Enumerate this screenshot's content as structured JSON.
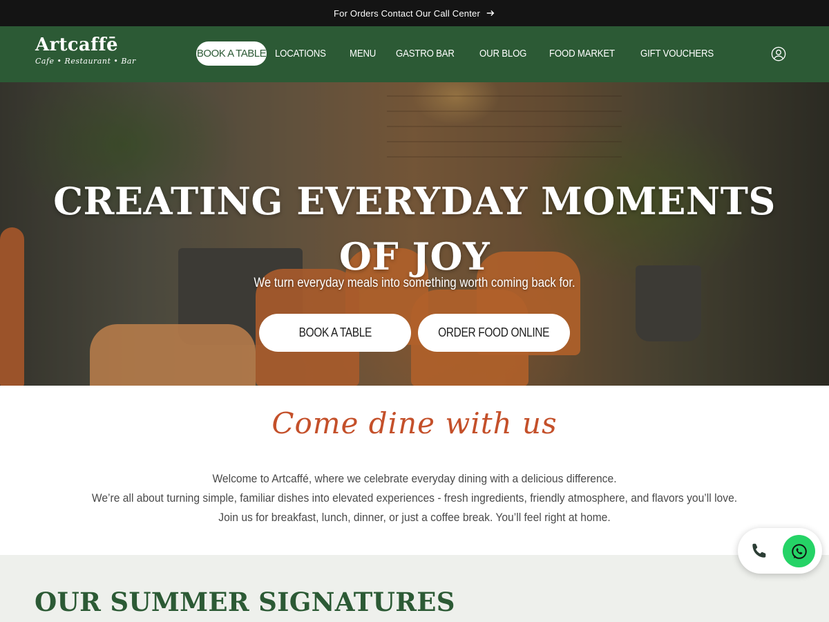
{
  "topbar": {
    "text": "For Orders Contact Our Call Center",
    "arrow_icon": "arrow-right-icon"
  },
  "brand": {
    "name": "Artcaffē",
    "tagline": "Cafe • Restaurant • Bar"
  },
  "nav": {
    "book_label": "BOOK A TABLE",
    "items": [
      {
        "label": "LOCATIONS"
      },
      {
        "label": "MENU"
      },
      {
        "label": "GASTRO BAR"
      },
      {
        "label": "OUR BLOG"
      },
      {
        "label": "FOOD MARKET"
      },
      {
        "label": "GIFT VOUCHERS"
      }
    ],
    "account_icon": "user-account-icon"
  },
  "hero": {
    "title": "CREATING EVERYDAY MOMENTS OF JOY",
    "subtitle": "We turn everyday meals into something worth coming back for.",
    "book_button": "BOOK A TABLE",
    "order_button": "ORDER FOOD ONLINE"
  },
  "intro": {
    "script_heading": "Come dine with us",
    "lines": [
      "Welcome to Artcaffé, where we celebrate everyday dining with a delicious difference.",
      "We’re all about turning simple, familiar dishes into elevated experiences - fresh ingredients, friendly atmosphere, and flavors you’ll love.",
      "Join us for breakfast, lunch, dinner, or just a coffee break. You’ll feel right at home."
    ]
  },
  "section": {
    "title": "OUR SUMMER SIGNATURES"
  },
  "contact_widget": {
    "phone_icon": "phone-icon",
    "whatsapp_icon": "whatsapp-icon"
  },
  "colors": {
    "nav_green": "#2c5a35",
    "accent_orange": "#c4502a",
    "topbar_black": "#141414",
    "whatsapp_green": "#25d366"
  }
}
